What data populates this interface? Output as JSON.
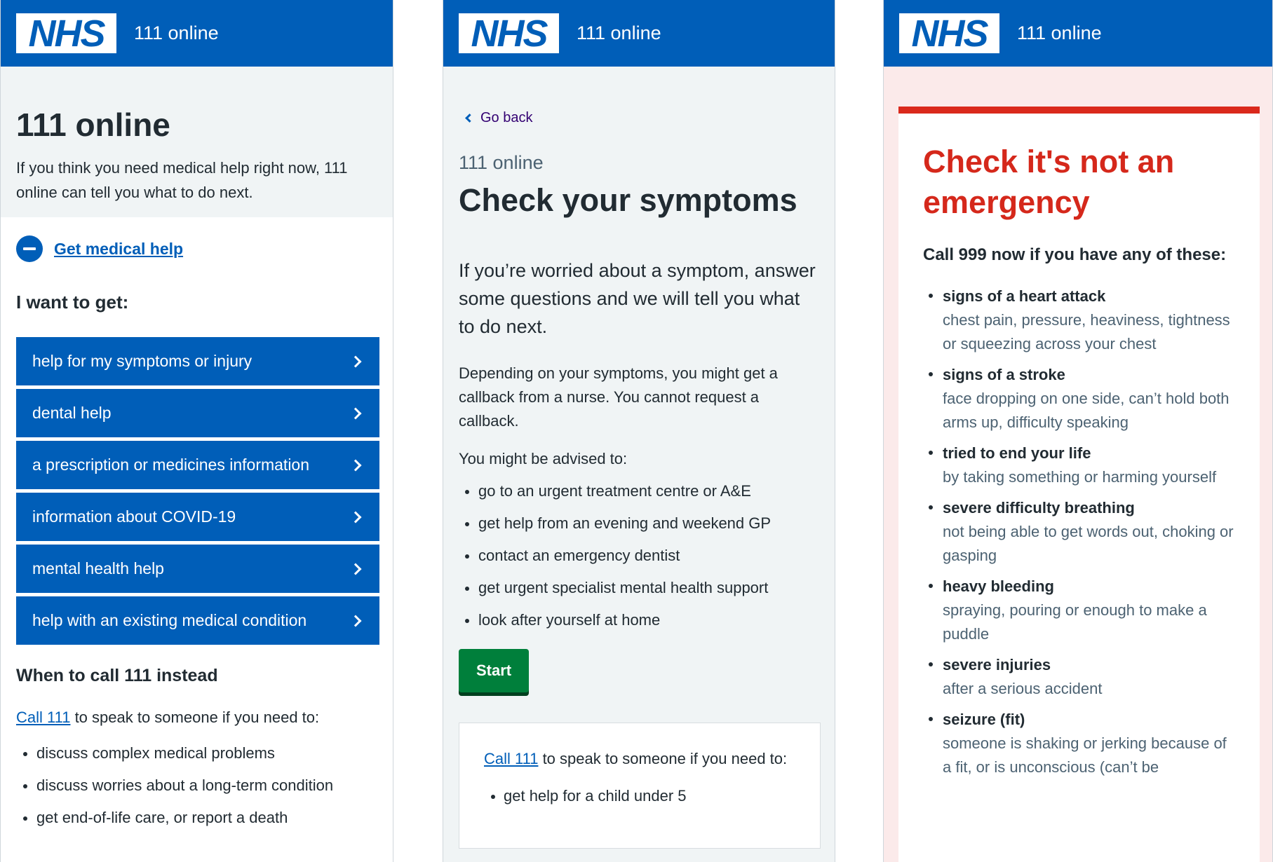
{
  "logo_text": "NHS",
  "screen1": {
    "header_title": "111 online",
    "title": "111 online",
    "intro": "If you think you need medical help right now, 111 online can tell you what to do next.",
    "get_help_link": "Get medical help",
    "want_heading": "I want to get:",
    "options": [
      {
        "label": "help for my symptoms or injury"
      },
      {
        "label": "dental help"
      },
      {
        "label": "a prescription or medicines information"
      },
      {
        "label": "information about COVID-19"
      },
      {
        "label": "mental health help"
      },
      {
        "label": "help with an existing medical condition"
      }
    ],
    "call_heading": "When to call 111 instead",
    "call_link": "Call 111",
    "call_text": " to speak to someone if you need to:",
    "bullets": [
      "discuss complex medical problems",
      "discuss worries about a long-term condition",
      "get end-of-life care, or report a death"
    ]
  },
  "screen2": {
    "header_title": "111 online",
    "go_back": "Go back",
    "caption": "111 online",
    "title": "Check your symptoms",
    "lede": "If you’re worried about a symptom, answer some questions and we will tell you what to do next.",
    "callback_text": "Depending on your symptoms, you might get a callback from a nurse. You cannot request a callback.",
    "advised_text": "You might be advised to:",
    "bullets": [
      "go to an urgent treatment centre or A&E",
      "get help from an evening and weekend GP",
      "contact an emergency dentist",
      "get urgent specialist mental health support",
      "look after yourself at home"
    ],
    "start_button": "Start",
    "call_link": "Call 111",
    "call_text": " to speak to someone if you need to:",
    "call_bullets": [
      "get help for a child under 5"
    ]
  },
  "screen3": {
    "header_title": "111 online",
    "title": "Check it's not an emergency",
    "lead": "Call 999 now if you have any of these:",
    "items": [
      {
        "title": "signs of a heart attack",
        "desc": "chest pain, pressure, heaviness, tightness or squeezing across your chest"
      },
      {
        "title": "signs of a stroke",
        "desc": "face dropping on one side, can’t hold both arms up, difficulty speaking"
      },
      {
        "title": "tried to end your life",
        "desc": "by taking something or harming yourself"
      },
      {
        "title": "severe difficulty breathing",
        "desc": "not being able to get words out, choking or gasping"
      },
      {
        "title": "heavy bleeding",
        "desc": "spraying, pouring or enough to make a puddle"
      },
      {
        "title": "severe injuries",
        "desc": "after a serious accident"
      },
      {
        "title": "seizure (fit)",
        "desc": "someone is shaking or jerking because of a fit, or is unconscious (can’t be"
      }
    ]
  },
  "colors": {
    "nhs_blue": "#005eb8",
    "button_green": "#007f3b",
    "emergency_red": "#da291c",
    "page_grey": "#f0f4f5",
    "emergency_bg": "#fbeaea"
  }
}
